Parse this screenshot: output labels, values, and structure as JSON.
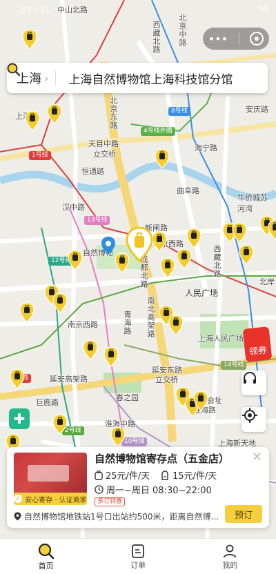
{
  "status_bar": {
    "left": "上午3:31",
    "right": "5G"
  },
  "map": {
    "roads": [
      "中山北路",
      "西藏北路",
      "北京中路",
      "上海站",
      "北京东路",
      "上海火车站",
      "天目中路",
      "立交桥",
      "恒通路",
      "海宁路",
      "曲阜路",
      "汉中路",
      "新闸路",
      "自然博物",
      "北京西路",
      "成都北路",
      "人民广场",
      "南京西路",
      "青海路",
      "南北高架路",
      "上海人民广场",
      "延安东路",
      "立交桥",
      "延安高架路",
      "巨鹿路",
      "春之园",
      "淮海中路",
      "会址",
      "淮海路",
      "上海新天地",
      "华侨城苏河湾",
      "安庆路",
      "西藏北路",
      "北岸"
    ],
    "metro_tags": [
      {
        "text": "8号线",
        "color": "#3a8ee6"
      },
      {
        "text": "4号线外圈",
        "color": "#5bb04a"
      },
      {
        "text": "1号线",
        "color": "#e13c3c"
      },
      {
        "text": "13号线",
        "color": "#e27fc0"
      },
      {
        "text": "12号线",
        "color": "#2aa98a"
      },
      {
        "text": "2号线",
        "color": "#5aa83d"
      },
      {
        "text": "10号线",
        "color": "#b492c8"
      },
      {
        "text": "14号线",
        "color": "#8aa85f"
      },
      {
        "text": "线",
        "color": "#e13c3c"
      }
    ]
  },
  "search": {
    "city": "上海",
    "query": "上海自然博物馆上海科技馆分馆"
  },
  "coupon_label": "领券",
  "card": {
    "title": "自然博物馆寄存点（五金店）",
    "price_small": "25元/件/天",
    "price_large": "15元/件/天",
    "hours": "周一~周日 08:30~22:00",
    "badge": "多订特惠",
    "trust": "安心寄存 · 认证商家",
    "address": "自然博物馆地铁站1号口出站约500米，距离自然博...",
    "book": "预订"
  },
  "tabs": [
    {
      "label": "首页",
      "active": true
    },
    {
      "label": "订单",
      "active": false
    },
    {
      "label": "我的",
      "active": false
    }
  ]
}
